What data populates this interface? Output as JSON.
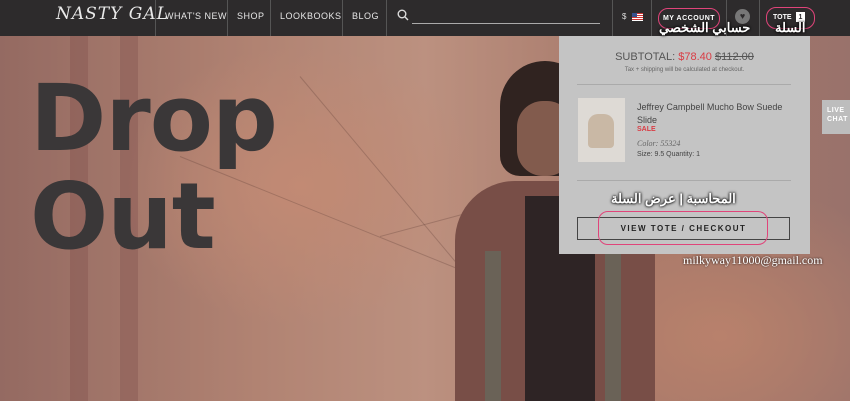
{
  "nav": {
    "logo": "NASTY GAL",
    "items": [
      "WHAT'S NEW",
      "SHOP",
      "LOOKBOOKS",
      "BLOG"
    ],
    "currency": "$",
    "my_account": "MY ACCOUNT",
    "tote": "TOTE",
    "tote_count": "1"
  },
  "hero": {
    "headline_line1": "Drop",
    "headline_line2": "Out"
  },
  "tote_panel": {
    "subtotal_label": "SUBTOTAL:",
    "subtotal_price": "$78.40",
    "subtotal_original": "$112.00",
    "tax_note": "Tax + shipping will be calculated at checkout.",
    "product": {
      "name": "Jeffrey Campbell Mucho Bow Suede Slide",
      "sale_label": "SALE",
      "color": "Color: 55324",
      "size_qty": "Size: 9.5   Quantity: 1"
    },
    "view_button": "VIEW TOTE / CHECKOUT"
  },
  "live_chat": {
    "line1": "LIVE",
    "line2": "CHAT"
  },
  "annotations": {
    "account": "حسابي الشخصي",
    "tote": "السلة",
    "checkout": "المحاسبة | عرض السلة",
    "watermark": "milkyway11000@gmail.com"
  },
  "colors": {
    "accent": "#e0447a",
    "sale": "#d93c44",
    "nav_bg": "#2d2b2c"
  }
}
